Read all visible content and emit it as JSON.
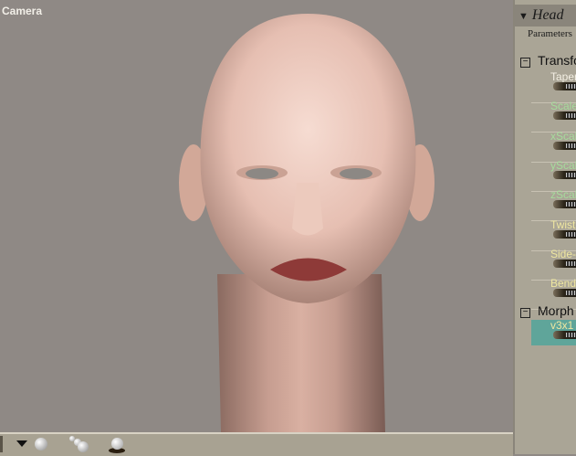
{
  "viewport": {
    "camera_label": "Camera"
  },
  "panel": {
    "title": "Head",
    "tab": "Parameters",
    "groups": [
      {
        "label": "Transform",
        "params": [
          {
            "label": "Taper",
            "color": "#f4f0e4"
          },
          {
            "label": "Scale",
            "color": "#a6dc9c"
          },
          {
            "label": "xScale",
            "color": "#a6dc9c"
          },
          {
            "label": "yScale",
            "color": "#a6dc9c"
          },
          {
            "label": "zScale",
            "color": "#a6dc9c"
          },
          {
            "label": "Twist",
            "color": "#eee6a0"
          },
          {
            "label": "Side-Side",
            "color": "#eee6a0"
          },
          {
            "label": "Bend",
            "color": "#eee6a0"
          }
        ]
      },
      {
        "label": "Morph",
        "params": [
          {
            "label": "v3x1",
            "color": "#eee6a0",
            "selected": true
          }
        ]
      }
    ]
  },
  "bottom": {
    "icons": [
      "menu-triangle-icon",
      "light-sphere-icon",
      "multi-light-icon",
      "render-sphere-icon"
    ]
  }
}
